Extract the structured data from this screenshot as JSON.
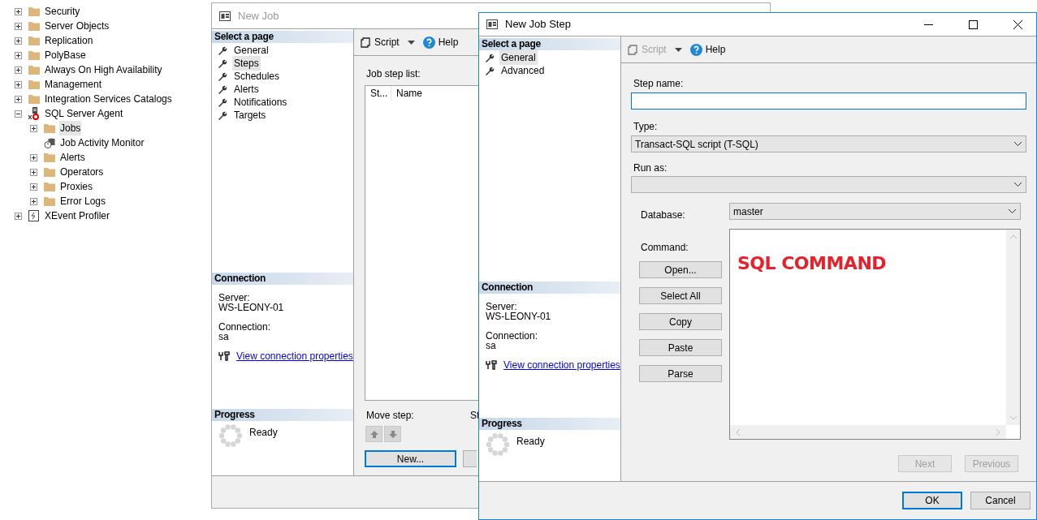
{
  "object_explorer": {
    "items": [
      {
        "label": "Security",
        "kind": "folder",
        "expandable": true,
        "expanded": false,
        "selected": false
      },
      {
        "label": "Server Objects",
        "kind": "folder",
        "expandable": true,
        "expanded": false,
        "selected": false
      },
      {
        "label": "Replication",
        "kind": "folder",
        "expandable": true,
        "expanded": false,
        "selected": false
      },
      {
        "label": "PolyBase",
        "kind": "folder",
        "expandable": true,
        "expanded": false,
        "selected": false
      },
      {
        "label": "Always On High Availability",
        "kind": "folder",
        "expandable": true,
        "expanded": false,
        "selected": false
      },
      {
        "label": "Management",
        "kind": "folder",
        "expandable": true,
        "expanded": false,
        "selected": false
      },
      {
        "label": "Integration Services Catalogs",
        "kind": "folder",
        "expandable": true,
        "expanded": false,
        "selected": false
      },
      {
        "label": "SQL Server Agent",
        "kind": "agent",
        "expandable": true,
        "expanded": true,
        "selected": false,
        "children": [
          {
            "label": "Jobs",
            "kind": "folder",
            "expandable": true,
            "expanded": false,
            "selected": true
          },
          {
            "label": "Job Activity Monitor",
            "kind": "monitor",
            "expandable": false,
            "expanded": false,
            "selected": false
          },
          {
            "label": "Alerts",
            "kind": "folder",
            "expandable": true,
            "expanded": false,
            "selected": false
          },
          {
            "label": "Operators",
            "kind": "folder",
            "expandable": true,
            "expanded": false,
            "selected": false
          },
          {
            "label": "Proxies",
            "kind": "folder",
            "expandable": true,
            "expanded": false,
            "selected": false
          },
          {
            "label": "Error Logs",
            "kind": "folder",
            "expandable": true,
            "expanded": false,
            "selected": false
          }
        ]
      },
      {
        "label": "XEvent Profiler",
        "kind": "profiler",
        "expandable": true,
        "expanded": false,
        "selected": false
      }
    ]
  },
  "new_job_window": {
    "title": "New Job",
    "active": false,
    "select_heading": "Select a page",
    "pages": [
      {
        "label": "General",
        "selected": false
      },
      {
        "label": "Steps",
        "selected": true
      },
      {
        "label": "Schedules",
        "selected": false
      },
      {
        "label": "Alerts",
        "selected": false
      },
      {
        "label": "Notifications",
        "selected": false
      },
      {
        "label": "Targets",
        "selected": false
      }
    ],
    "toolbar": {
      "script": "Script",
      "script_disabled": false,
      "help": "Help"
    },
    "connection_heading": "Connection",
    "server_label": "Server:",
    "server": "WS-LEONY-01",
    "connection_label": "Connection:",
    "connection": "sa",
    "view_link": "View connection properties",
    "progress_heading": "Progress",
    "progress_status": "Ready",
    "job_step_list_label": "Job step list:",
    "columns": [
      "St...",
      "Name"
    ],
    "move_step_label": "Move step:",
    "cut_label": "St",
    "new_button": {
      "label": "New...",
      "default": true
    }
  },
  "new_job_step_window": {
    "title": "New Job Step",
    "active": true,
    "select_heading": "Select a page",
    "pages": [
      {
        "label": "General",
        "selected": true
      },
      {
        "label": "Advanced",
        "selected": false
      }
    ],
    "toolbar": {
      "script": "Script",
      "script_disabled": true,
      "help": "Help"
    },
    "connection_heading": "Connection",
    "server_label": "Server:",
    "server": "WS-LEONY-01",
    "connection_label": "Connection:",
    "connection": "sa",
    "view_link": "View connection properties",
    "progress_heading": "Progress",
    "progress_status": "Ready",
    "step_name_label": "Step name:",
    "type_label": "Type:",
    "type_value": "Transact-SQL script (T-SQL)",
    "run_as_label": "Run as:",
    "database_label": "Database:",
    "database_value": "master",
    "command_label": "Command:",
    "command_text": "SQL COMMAND",
    "command_buttons": [
      "Open...",
      "Select All",
      "Copy",
      "Paste",
      "Parse"
    ],
    "nav_buttons": [
      {
        "label": "Next",
        "disabled": true
      },
      {
        "label": "Previous",
        "disabled": true
      }
    ],
    "footer_buttons": [
      {
        "label": "OK",
        "default": true
      },
      {
        "label": "Cancel",
        "default": false
      }
    ]
  }
}
